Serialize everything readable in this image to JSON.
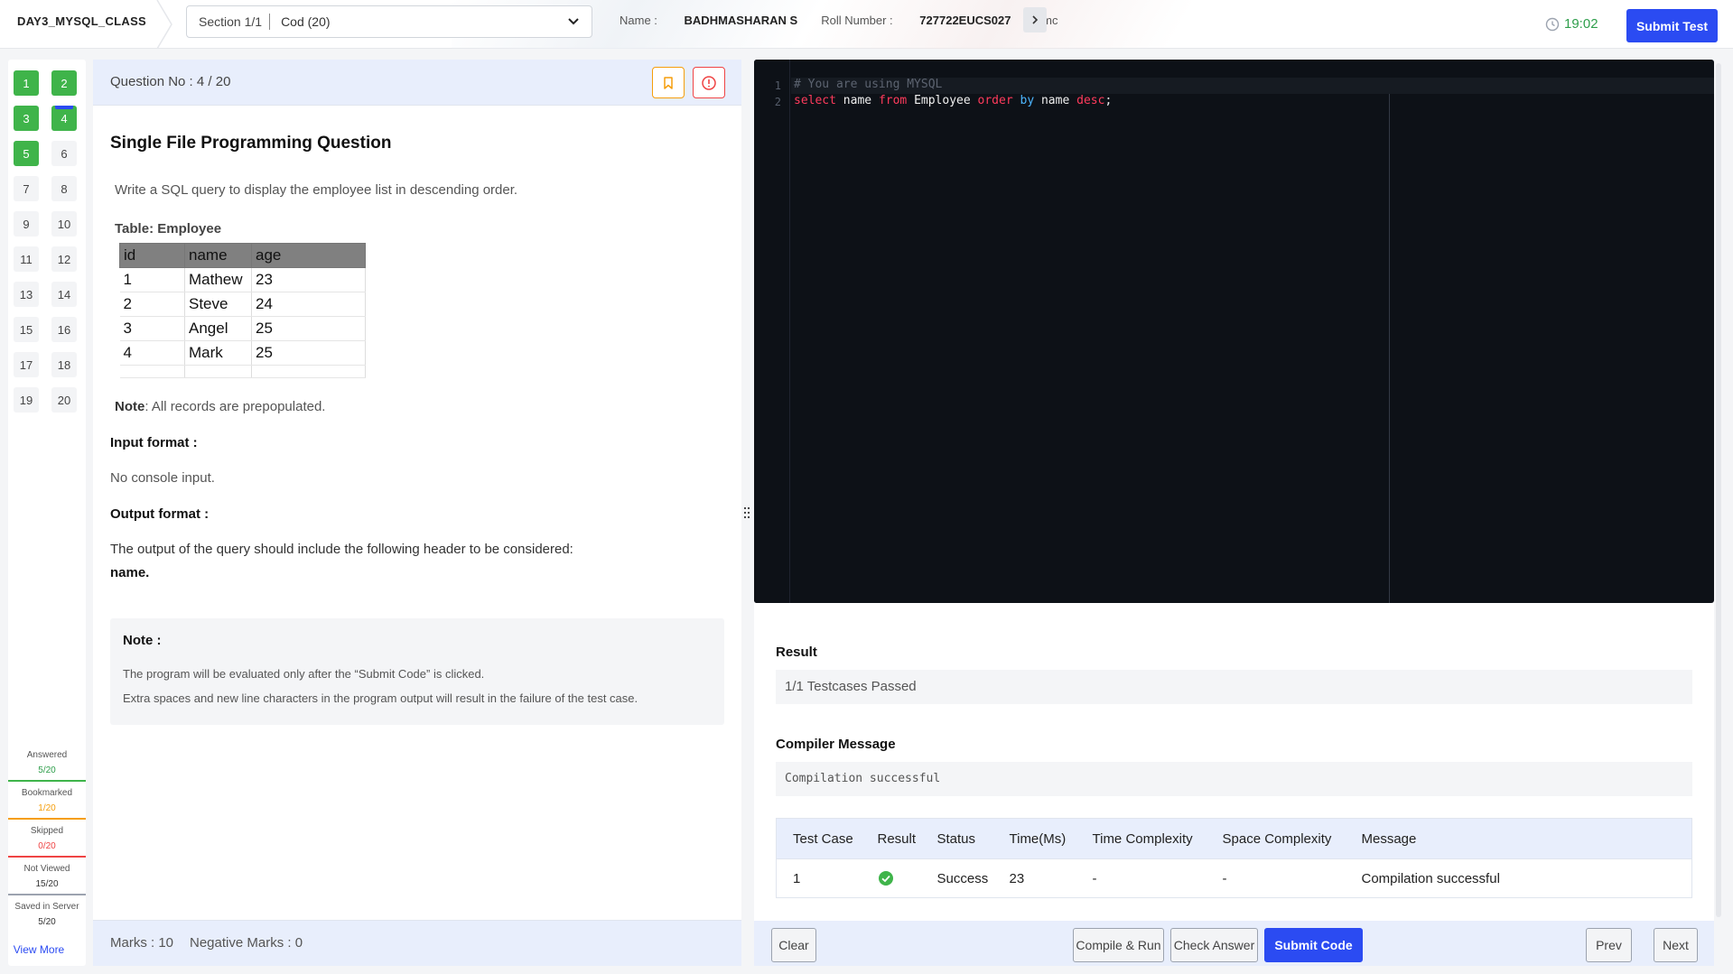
{
  "header": {
    "test_title": "DAY3_MYSQL_CLASS",
    "section_label": "Section 1/1",
    "section_value": "Cod (20)",
    "name_label": "Name :",
    "name_value": "BADHMASHARAN S",
    "roll_label": "Roll Number :",
    "roll_value": "727722EUCS027",
    "extra_label": "Emc",
    "timer": "19:02",
    "submit_test_label": "Submit Test"
  },
  "nav": {
    "questions": [
      {
        "n": "1",
        "state": "done"
      },
      {
        "n": "2",
        "state": "done"
      },
      {
        "n": "3",
        "state": "done"
      },
      {
        "n": "4",
        "state": "current"
      },
      {
        "n": "5",
        "state": "done"
      },
      {
        "n": "6",
        "state": "none"
      },
      {
        "n": "7",
        "state": "none"
      },
      {
        "n": "8",
        "state": "none"
      },
      {
        "n": "9",
        "state": "none"
      },
      {
        "n": "10",
        "state": "none"
      },
      {
        "n": "11",
        "state": "none"
      },
      {
        "n": "12",
        "state": "none"
      },
      {
        "n": "13",
        "state": "none"
      },
      {
        "n": "14",
        "state": "none"
      },
      {
        "n": "15",
        "state": "none"
      },
      {
        "n": "16",
        "state": "none"
      },
      {
        "n": "17",
        "state": "none"
      },
      {
        "n": "18",
        "state": "none"
      },
      {
        "n": "19",
        "state": "none"
      },
      {
        "n": "20",
        "state": "none"
      }
    ],
    "legend": {
      "answered_label": "Answered",
      "answered_value": "5/20",
      "bookmarked_label": "Bookmarked",
      "bookmarked_value": "1/20",
      "skipped_label": "Skipped",
      "skipped_value": "0/20",
      "notviewed_label": "Not Viewed",
      "notviewed_value": "15/20",
      "saved_label": "Saved in Server",
      "saved_value": "5/20"
    },
    "view_more": "View More"
  },
  "question": {
    "number": "Question No : 4 / 20",
    "title": "Single File Programming Question",
    "description": "Write a SQL query to display the employee list in descending order.",
    "table_caption": "Table: Employee",
    "table": {
      "columns": [
        "id",
        "name",
        "age"
      ],
      "rows": [
        [
          "1",
          "Mathew",
          "23"
        ],
        [
          "2",
          "Steve",
          "24"
        ],
        [
          "3",
          "Angel",
          "25"
        ],
        [
          "4",
          "Mark",
          "25"
        ]
      ]
    },
    "note_label": "Note",
    "note_text": ": All records are prepopulated.",
    "input_label": "Input format :",
    "input_text": "No console input.",
    "output_label": "Output format :",
    "output_text": "The output of the query should include the following header to be considered:",
    "output_header": "name.",
    "notebox_title": "Note :",
    "notebox_line1": "The program will be evaluated only after the “Submit Code” is clicked.",
    "notebox_line2": "Extra spaces and new line characters in the program output will result in the failure of the test case.",
    "marks": "Marks : 10",
    "negative_marks": "Negative Marks : 0"
  },
  "editor": {
    "line_numbers": [
      "1",
      "2"
    ],
    "comment_line": "# You are using MYSQL",
    "code_tokens": {
      "t1": "select",
      "t2": " name ",
      "t3": "from",
      "t4": " Employee ",
      "t5": "order",
      "t6": " by",
      "t7": " name ",
      "t8": "desc",
      "t9": ";"
    }
  },
  "result": {
    "result_label": "Result",
    "result_value": "1/1 Testcases Passed",
    "compiler_label": "Compiler Message",
    "compiler_value": "Compilation successful",
    "columns": [
      "Test Case",
      "Result",
      "Status",
      "Time(Ms)",
      "Time Complexity",
      "Space Complexity",
      "Message"
    ],
    "rows": [
      {
        "case": "1",
        "result_icon": "check-circle-icon",
        "status": "Success",
        "time": "23",
        "time_complexity": "-",
        "space_complexity": "-",
        "message": "Compilation successful"
      }
    ]
  },
  "actions": {
    "clear": "Clear",
    "compile_run": "Compile & Run",
    "check_answer": "Check Answer",
    "submit_code": "Submit Code",
    "prev": "Prev",
    "next": "Next"
  },
  "colors": {
    "accent": "#2b4bf2",
    "answered": "#3fb44a",
    "bookmarked": "#f59e0b",
    "skipped": "#ef4444",
    "editor_bg": "#0d1117"
  }
}
